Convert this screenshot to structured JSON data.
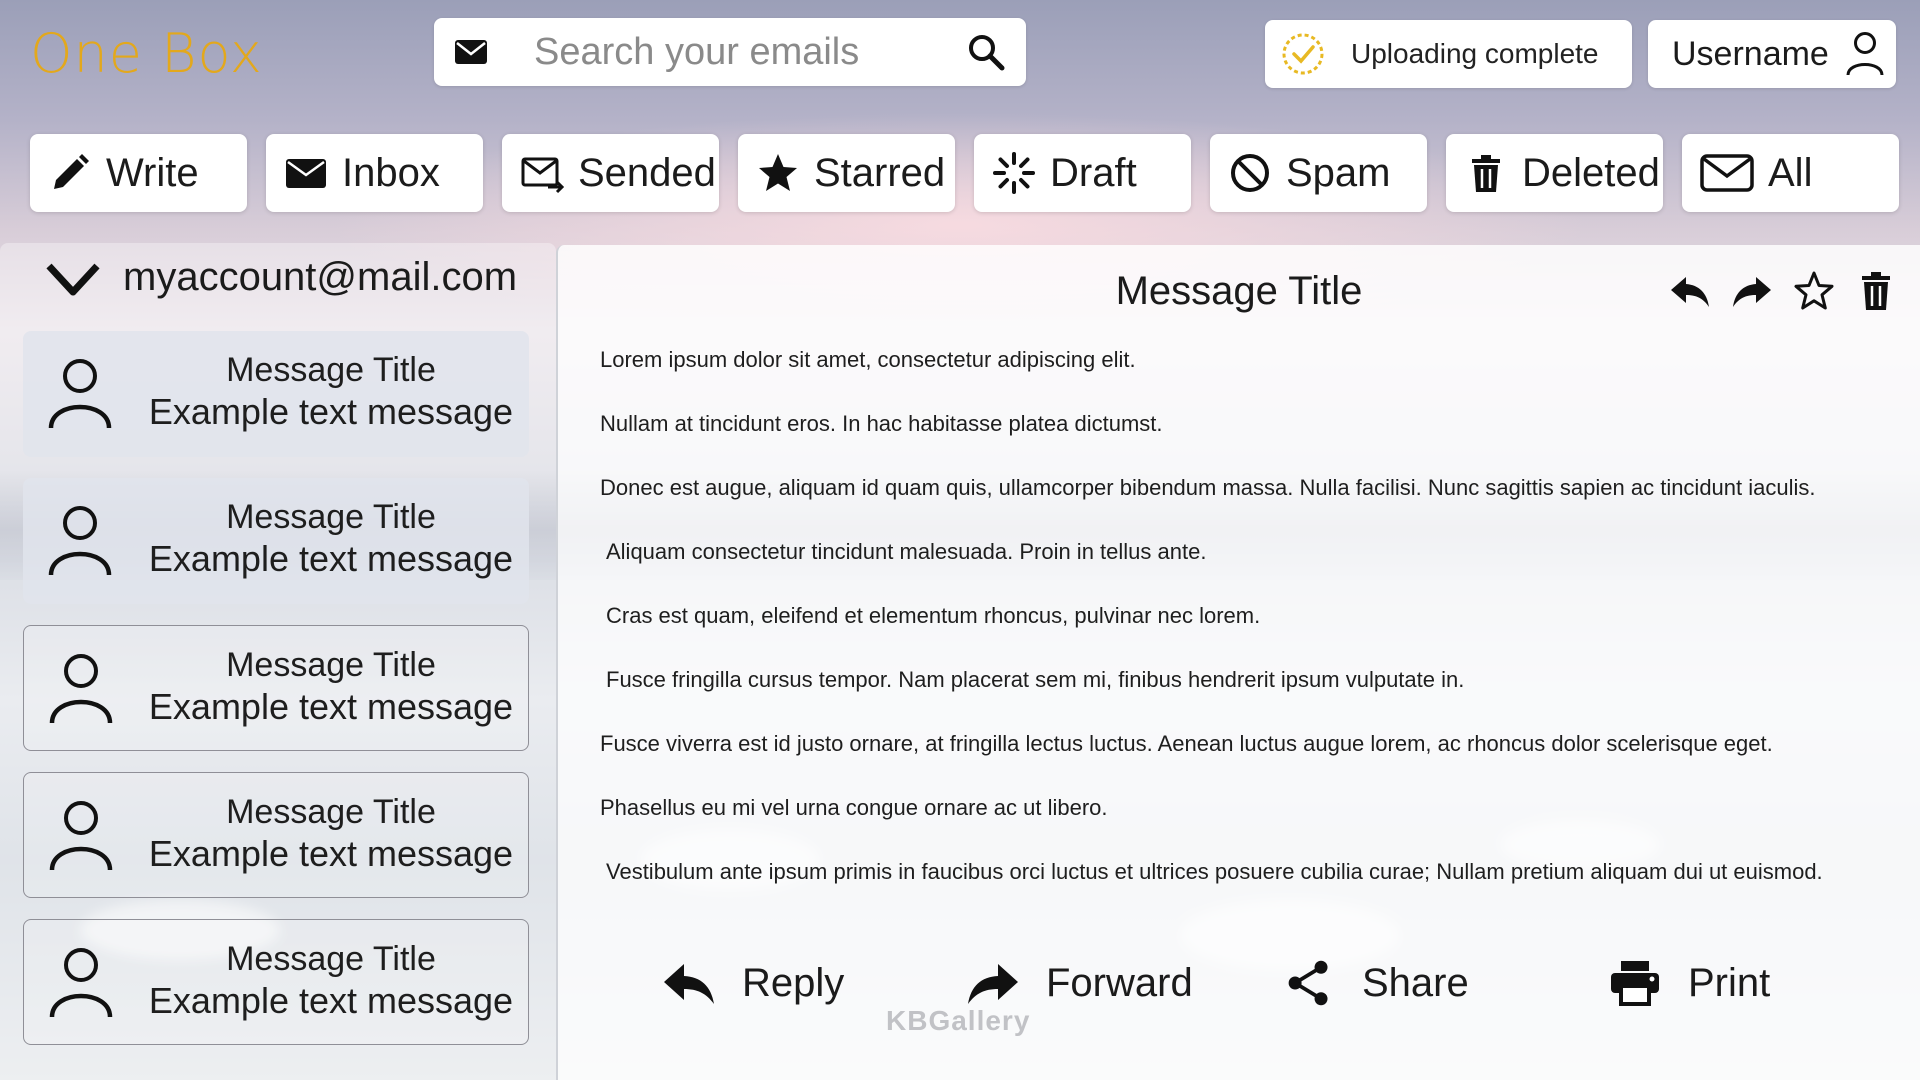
{
  "app": {
    "logo": "One Box"
  },
  "search": {
    "placeholder": "Search your emails"
  },
  "status": {
    "upload": "Uploading complete"
  },
  "user": {
    "name": "Username"
  },
  "nav": [
    {
      "label": "Write",
      "icon": "pencil-icon"
    },
    {
      "label": "Inbox",
      "icon": "envelope-filled-icon"
    },
    {
      "label": "Sended",
      "icon": "envelope-sent-icon"
    },
    {
      "label": "Starred",
      "icon": "star-filled-icon"
    },
    {
      "label": "Draft",
      "icon": "spinner-icon"
    },
    {
      "label": "Spam",
      "icon": "block-icon"
    },
    {
      "label": "Deleted",
      "icon": "trash-icon"
    },
    {
      "label": "All",
      "icon": "envelope-outline-icon"
    }
  ],
  "account": {
    "email": "myaccount@mail.com"
  },
  "messages": [
    {
      "title": "Message Title",
      "preview": "Example text message",
      "style": "filled"
    },
    {
      "title": "Message Title",
      "preview": "Example text message",
      "style": "filled"
    },
    {
      "title": "Message Title",
      "preview": "Example text message",
      "style": "outlined"
    },
    {
      "title": "Message Title",
      "preview": "Example text message",
      "style": "outlined"
    },
    {
      "title": "Message Title",
      "preview": "Example text message",
      "style": "outlined"
    }
  ],
  "reader": {
    "title": "Message Title",
    "body": [
      "Lorem ipsum dolor sit amet, consectetur adipiscing elit.",
      "Nullam at tincidunt eros. In hac habitasse platea dictumst.",
      "Donec est augue, aliquam id quam quis, ullamcorper bibendum massa. Nulla facilisi. Nunc sagittis sapien ac tincidunt iaculis.",
      "Aliquam consectetur tincidunt malesuada. Proin in tellus ante.",
      "Cras est quam, eleifend et elementum rhoncus, pulvinar nec lorem.",
      "Fusce fringilla cursus tempor. Nam placerat sem mi, finibus hendrerit ipsum vulputate in.",
      "Fusce viverra est id justo ornare, at fringilla lectus luctus. Aenean luctus augue lorem, ac rhoncus dolor scelerisque eget.",
      "Phasellus eu mi vel urna congue ornare ac ut libero.",
      "Vestibulum ante ipsum primis in faucibus orci luctus et ultrices posuere cubilia curae; Nullam pretium aliquam dui ut euismod."
    ],
    "actions": {
      "reply": "Reply",
      "forward": "Forward",
      "share": "Share",
      "print": "Print"
    }
  },
  "watermark": "KBGallery",
  "colors": {
    "brand": "#e3a81c",
    "upload_ring": "#e8b923"
  }
}
